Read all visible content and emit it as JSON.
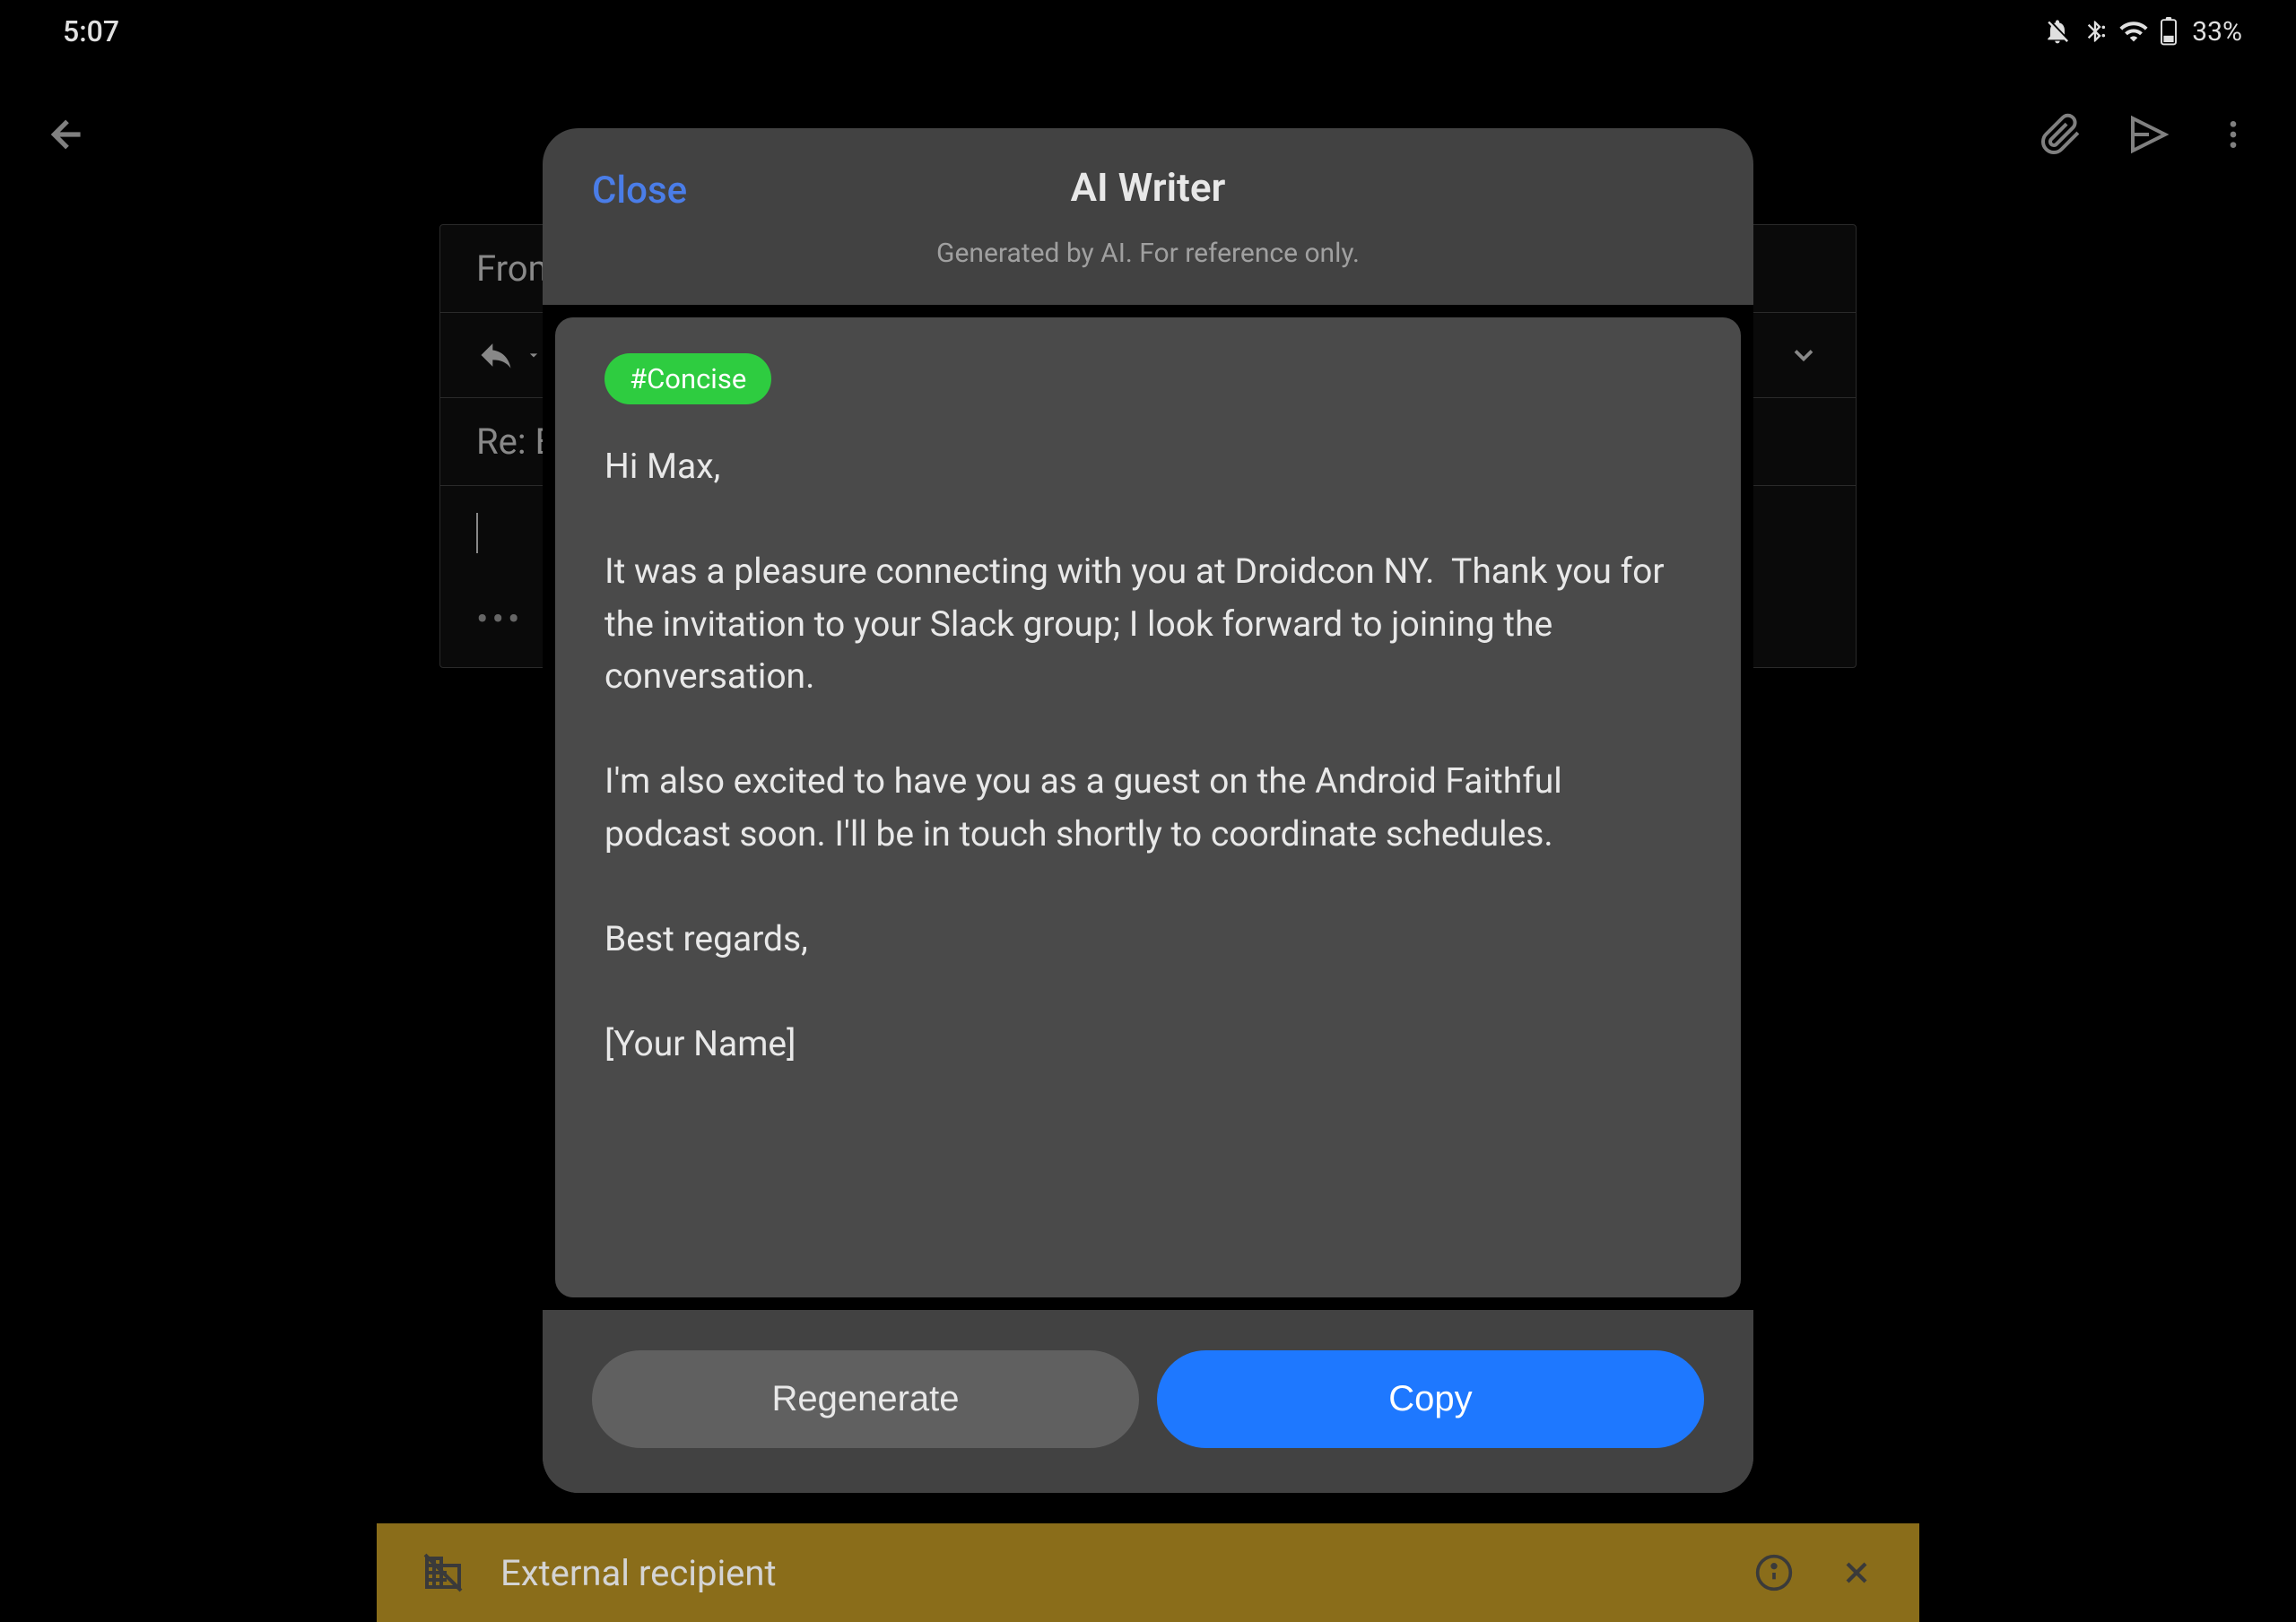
{
  "status": {
    "time": "5:07",
    "battery": "33%"
  },
  "compose": {
    "from_label": "From",
    "subject": "Re: E"
  },
  "banner": {
    "text": "External recipient"
  },
  "modal": {
    "close": "Close",
    "title": "AI Writer",
    "subtitle": "Generated by AI. For reference only.",
    "tag": "#Concise",
    "body": "Hi Max,\n\nIt was a pleasure connecting with you at Droidcon NY.  Thank you for the invitation to your Slack group; I look forward to joining the conversation.\n\nI'm also excited to have you as a guest on the Android Faithful podcast soon. I'll be in touch shortly to coordinate schedules.\n\nBest regards,\n\n[Your Name]",
    "regenerate": "Regenerate",
    "copy": "Copy"
  }
}
